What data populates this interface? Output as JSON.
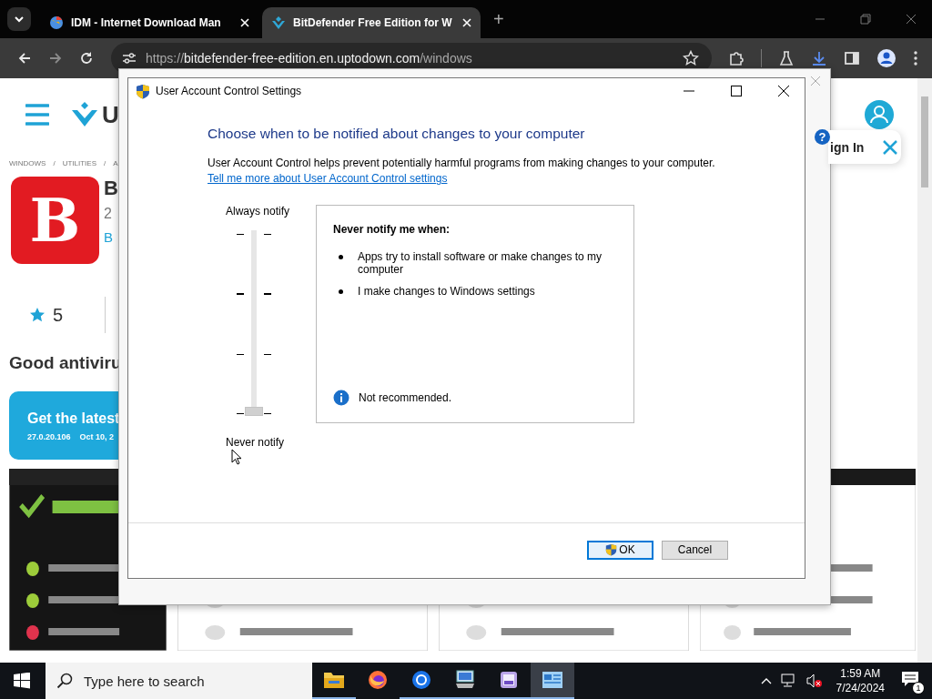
{
  "browser": {
    "tabs": [
      {
        "title": "IDM - Internet Download Man",
        "kind": "globe",
        "selected": false
      },
      {
        "title": "BitDefender Free Edition for W",
        "kind": "uptodown",
        "selected": true
      }
    ],
    "new_tab": "+",
    "nav": [
      {
        "kind": "back",
        "disabled": false
      },
      {
        "kind": "forward",
        "disabled": true
      },
      {
        "kind": "reload",
        "disabled": false
      }
    ],
    "url": {
      "scheme": "https://",
      "host": "bitdefender-free-edition.en.uptodown.com",
      "path": "/windows"
    }
  },
  "page": {
    "logo_letter": "U",
    "breadcrumb": [
      "WINDOWS",
      "UTILITIES",
      "A"
    ],
    "breadcrumb_separator": "/",
    "app_icon_letter": "B",
    "title": "B",
    "subtitle": "2",
    "author": "B",
    "rating": "5",
    "heading": "Good antiviru",
    "banner": {
      "title": "Get the latest",
      "version": "27.0.20.106",
      "date": "Oct 10, 2"
    },
    "sign_in": {
      "help": "?",
      "label": "ign In"
    }
  },
  "dialog": {
    "title": "User Account Control Settings",
    "heading": "Choose when to be notified about changes to your computer",
    "description": "User Account Control helps prevent potentially harmful programs from making changes to your computer.",
    "link": "Tell me more about User Account Control settings",
    "slider": {
      "top_label": "Always notify",
      "bottom_label": "Never notify",
      "level": 0
    },
    "panel": {
      "title": "Never notify me when:",
      "bullets": [
        "Apps try to install software or make changes to my computer",
        "I make changes to Windows settings"
      ],
      "note": "Not recommended."
    },
    "buttons": [
      {
        "label": "OK",
        "kind": "ok",
        "focused": true
      },
      {
        "label": "Cancel",
        "kind": "cancel",
        "focused": false
      }
    ]
  },
  "taskbar": {
    "search_placeholder": "Type here to search",
    "apps": [
      {
        "kind": "explorer",
        "running": true,
        "active": false
      },
      {
        "kind": "firefox",
        "running": false,
        "active": false
      },
      {
        "kind": "chrome",
        "running": true,
        "active": false
      },
      {
        "kind": "computer",
        "running": true,
        "active": false
      },
      {
        "kind": "purple",
        "running": true,
        "active": false
      },
      {
        "kind": "control",
        "running": true,
        "active": true
      }
    ],
    "time": "1:59 AM",
    "date": "7/24/2024",
    "notifications": "1"
  }
}
